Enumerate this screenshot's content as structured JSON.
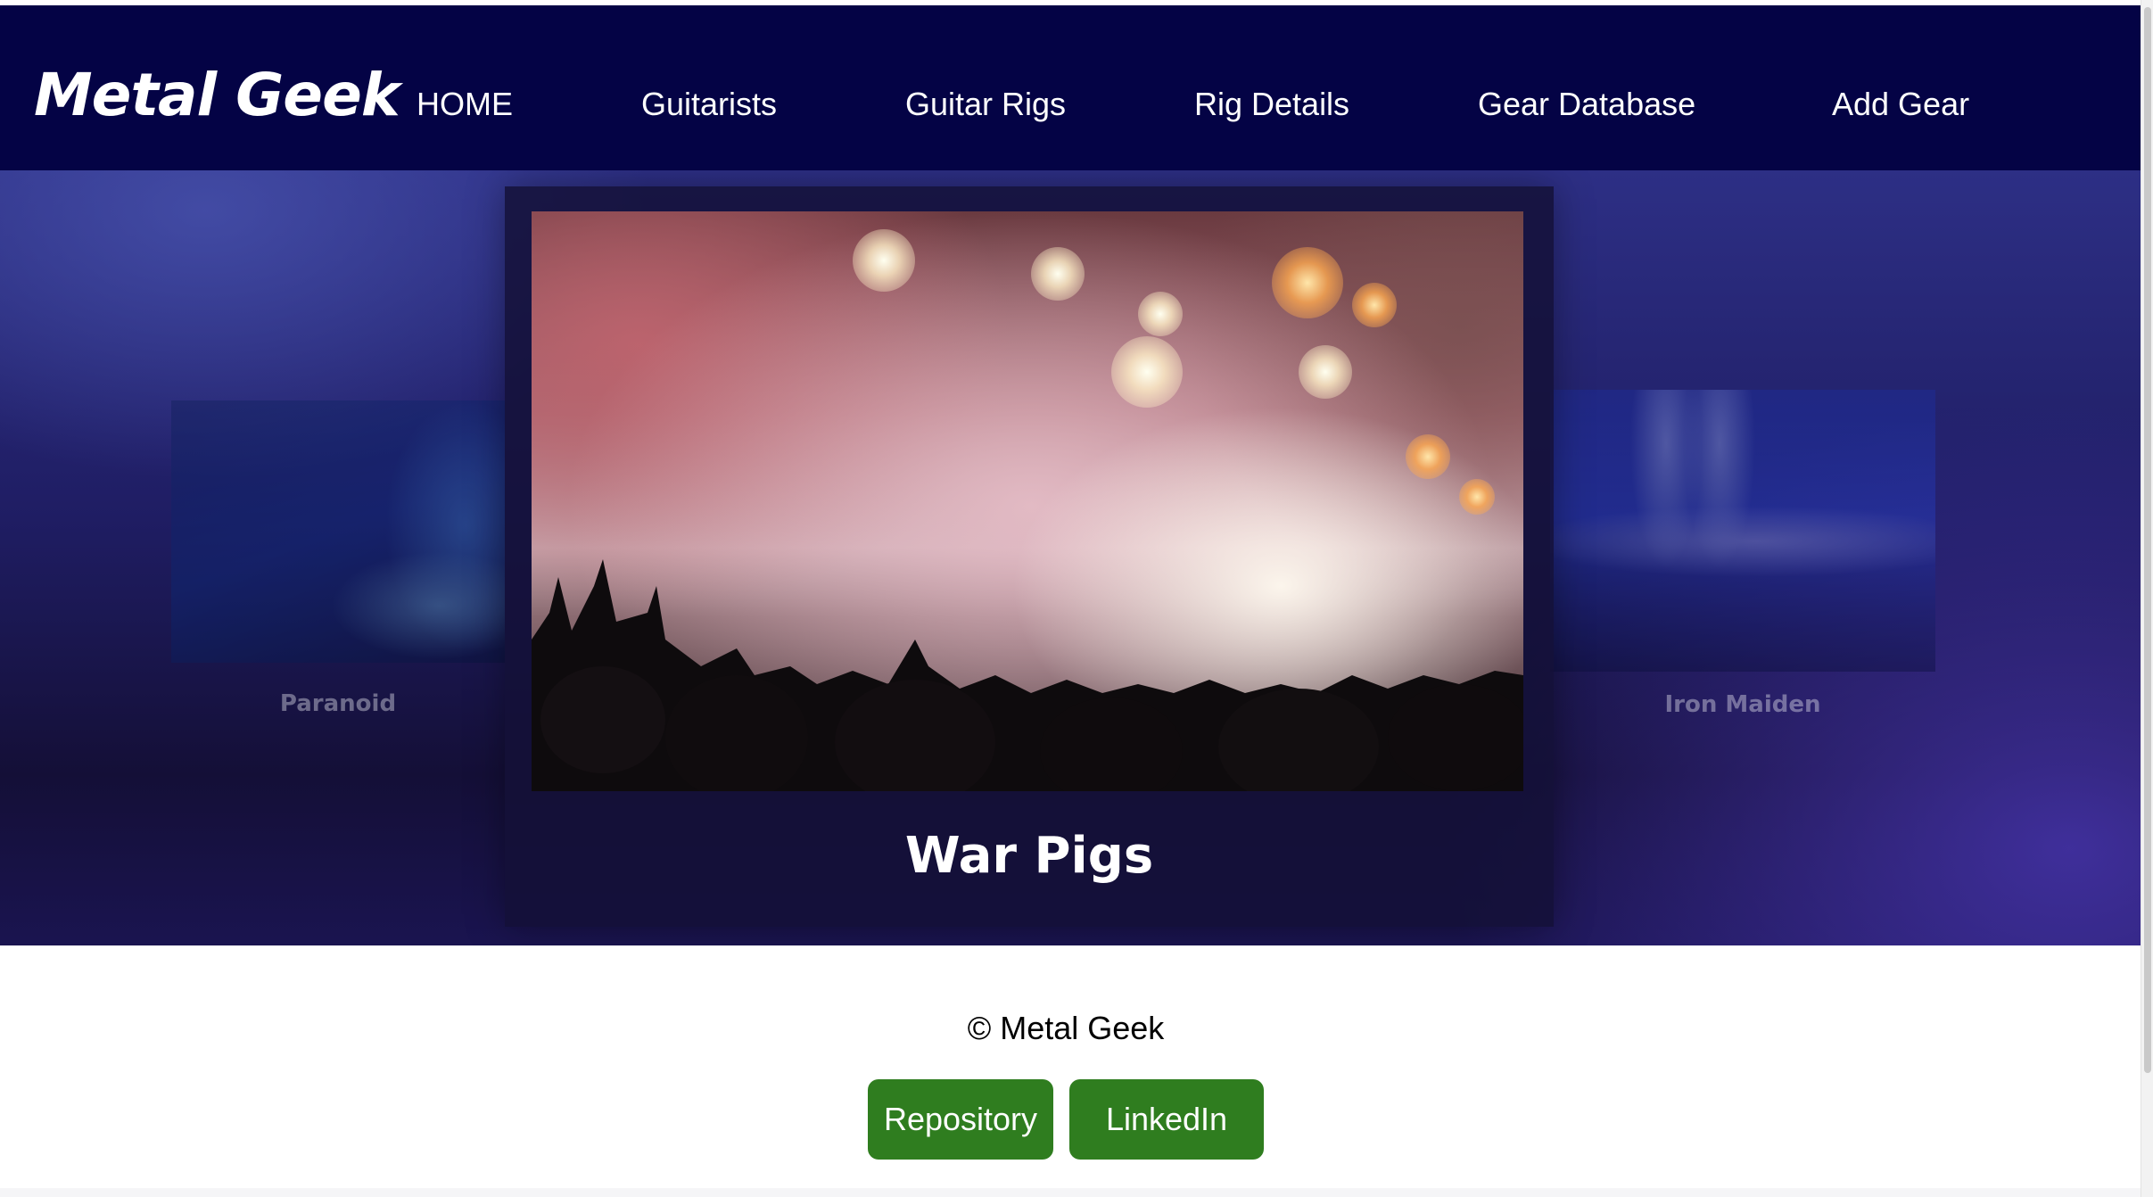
{
  "navbar": {
    "brand": "Metal Geek",
    "links": [
      {
        "label": "HOME"
      },
      {
        "label": "Guitarists"
      },
      {
        "label": "Guitar Rigs"
      },
      {
        "label": "Rig Details"
      },
      {
        "label": "Gear Database"
      },
      {
        "label": "Add Gear"
      }
    ],
    "background_color": "#040345"
  },
  "carousel": {
    "previous": {
      "caption": "Paranoid"
    },
    "current": {
      "caption": "War Pigs"
    },
    "next": {
      "caption": "Iron Maiden"
    }
  },
  "footer": {
    "copyright": "© Metal Geek",
    "buttons": [
      {
        "label": "Repository"
      },
      {
        "label": "LinkedIn"
      }
    ],
    "button_color": "#2f7d1f"
  }
}
